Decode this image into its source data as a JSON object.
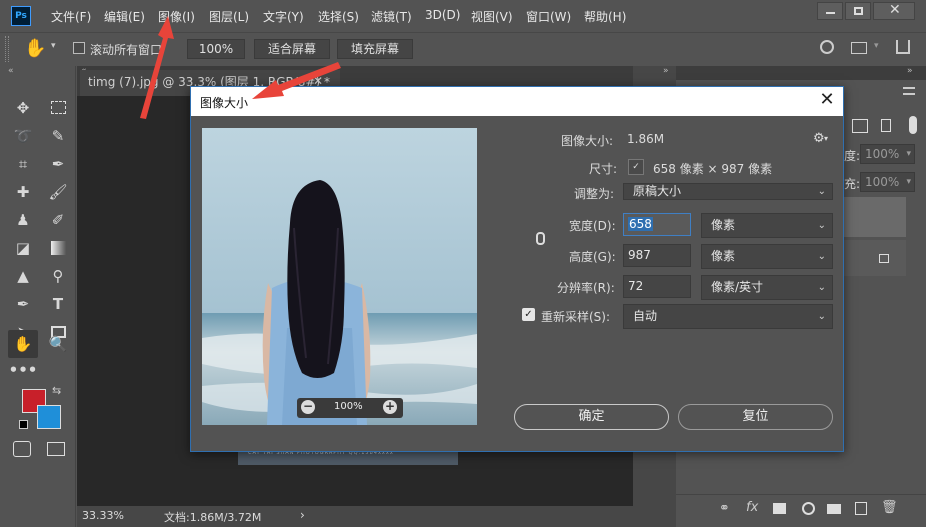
{
  "app": {
    "logo_text": "Ps"
  },
  "menu": {
    "items": [
      "文件(F)",
      "编辑(E)",
      "图像(I)",
      "图层(L)",
      "文字(Y)",
      "选择(S)",
      "滤镜(T)",
      "3D(D)",
      "视图(V)",
      "窗口(W)",
      "帮助(H)"
    ]
  },
  "options_bar": {
    "scroll_all_label": "滚动所有窗口",
    "zoom_value": "100%",
    "fit_screen_label": "适合屏幕",
    "fill_screen_label": "填充屏幕"
  },
  "document": {
    "tab_title": "timg (7).jpg @ 33.3% (图层 1, RGB/8#) *",
    "image_caption": "CAT TAI SHAN PHOTOGRAPHY   QQ:1584xxxx"
  },
  "status_bar": {
    "zoom": "33.33%",
    "doc_size": "文档:1.86M/3.72M",
    "arrow": "›"
  },
  "right_panel": {
    "opacity_1": "100%",
    "opacity_2": "100%",
    "label_1": "度:",
    "label_2": "充:"
  },
  "dialog": {
    "title": "图像大小",
    "image_size_label": "图像大小:",
    "image_size_value": "1.86M",
    "dimensions_label": "尺寸:",
    "dimensions_value": "658 像素 × 987 像素",
    "fit_to_label": "调整为:",
    "fit_to_value": "原稿大小",
    "width_label": "宽度(D):",
    "width_value": "658",
    "width_unit": "像素",
    "height_label": "高度(G):",
    "height_value": "987",
    "height_unit": "像素",
    "resolution_label": "分辨率(R):",
    "resolution_value": "72",
    "resolution_unit": "像素/英寸",
    "resample_label": "重新采样(S):",
    "resample_value": "自动",
    "resample_checked": true,
    "preview_zoom": "100%",
    "ok_label": "确定",
    "reset_label": "复位"
  },
  "colors": {
    "foreground": "#c8202a",
    "background": "#1f8fd9",
    "arrow": "#e8443a"
  }
}
